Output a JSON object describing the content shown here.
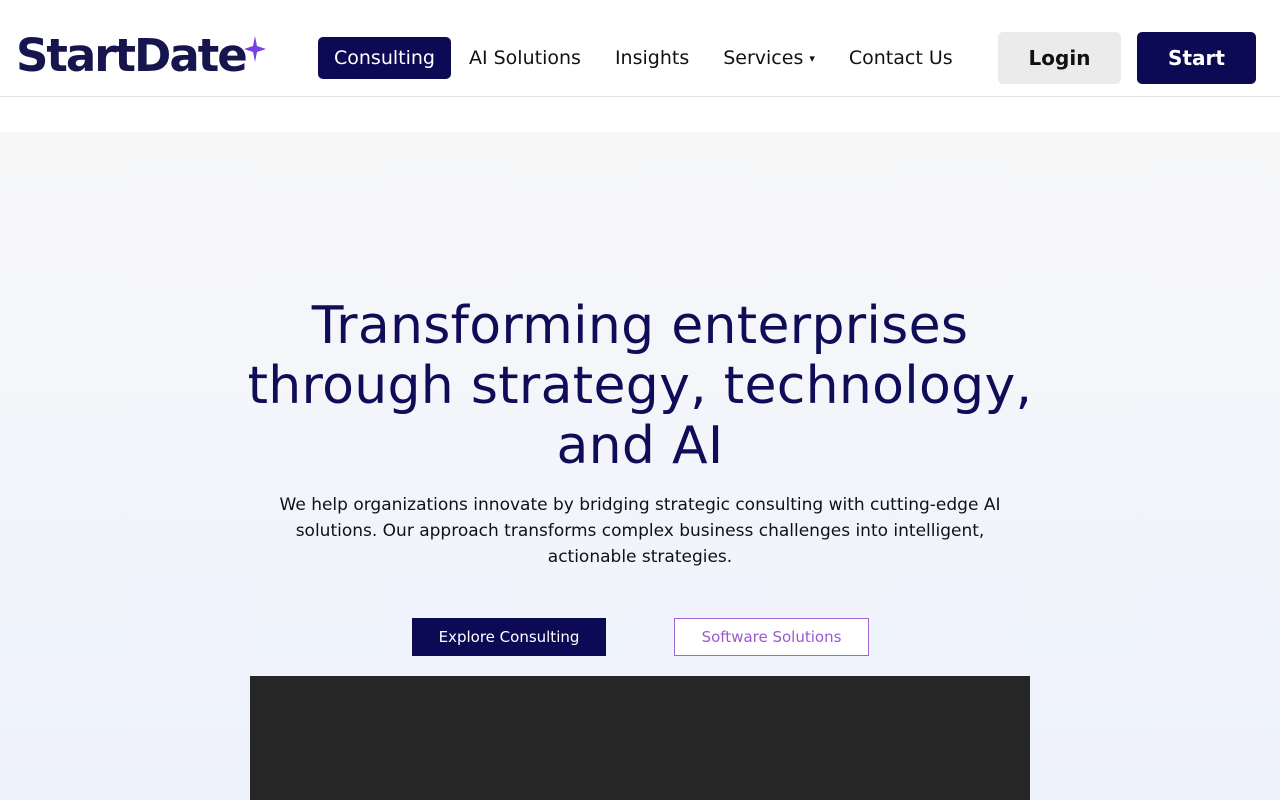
{
  "header": {
    "logo_text": "StartDate",
    "nav": [
      {
        "label": "Consulting",
        "active": true
      },
      {
        "label": "AI Solutions"
      },
      {
        "label": "Insights"
      },
      {
        "label": "Services"
      },
      {
        "label": "Contact Us"
      }
    ],
    "services_caret": "▾",
    "login_label": "Login",
    "start_label": "Start"
  },
  "hero": {
    "title": "Transforming enterprises through strategy, technology, and AI",
    "subtitle": "We help organizations innovate by bridging strategic consulting with cutting-edge AI solutions. Our approach transforms complex business challenges into intelligent, actionable strategies.",
    "primary_button": "Explore Consulting",
    "secondary_button": "Software Solutions"
  },
  "colors": {
    "brand_navy": "#0c0a55",
    "accent_purple": "#9b59d0",
    "spark_purple": "#7b3fe4"
  },
  "icons": {
    "logo_spark": "sparkle-icon",
    "services_caret": "caret-down-icon"
  }
}
